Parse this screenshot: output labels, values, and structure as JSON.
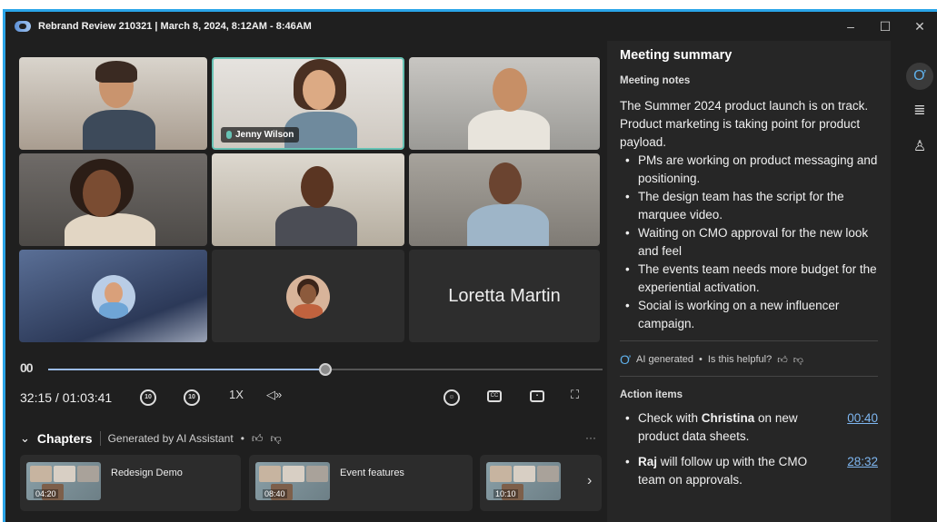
{
  "window": {
    "title": "Rebrand Review 210321 | March 8, 2024, 8:12AM - 8:46AM",
    "controls": [
      "–",
      "☐",
      "✕"
    ]
  },
  "video": {
    "highlight_name": "Jenny Wilson",
    "large_name_tile": "Loretta Martin",
    "accent_color": "#67c2b4"
  },
  "playback": {
    "pause_glyph": "00",
    "time": "32:15 / 01:03:41",
    "progress_fraction": 0.5,
    "skip_back_label": "10",
    "skip_forward_label": "10",
    "speed": "1X",
    "volume_glyph": "◁»",
    "captions_label": "CC"
  },
  "chapters": {
    "title": "Chapters",
    "generated_by": "Generated by AI Assistant",
    "more": "···",
    "items": [
      {
        "label": "Redesign Demo",
        "time": "04:20"
      },
      {
        "label": "Event features",
        "time": "08:40"
      },
      {
        "label": "",
        "time": "10:10"
      }
    ],
    "next": "›"
  },
  "summary": {
    "title": "Meeting summary",
    "notes_heading": "Meeting notes",
    "intro": "The Summer 2024 product launch is on track. Product marketing is taking point for product payload.",
    "notes": [
      "PMs are working on product messaging and positioning.",
      "The design team has the script for the marquee video.",
      "Waiting on CMO approval for the new look and feel",
      "The events team needs more budget for the experiential activation.",
      "Social is working on a new influencer campaign."
    ],
    "ai_label": "AI generated",
    "helpful_prompt": "Is this helpful?",
    "action_heading": "Action items",
    "actions": [
      {
        "bold": "Christina",
        "pre": "Check with ",
        "post": " on new product data sheets.",
        "time": "00:40"
      },
      {
        "bold": "Raj",
        "pre": "",
        "post": " will follow up with the CMO team on approvals.",
        "time": "28:32"
      }
    ]
  },
  "rail": {
    "copilot_glyph": "Ơ",
    "notes_glyph": "≣",
    "people_glyph": "♙"
  },
  "accent": "#2aa5e8"
}
